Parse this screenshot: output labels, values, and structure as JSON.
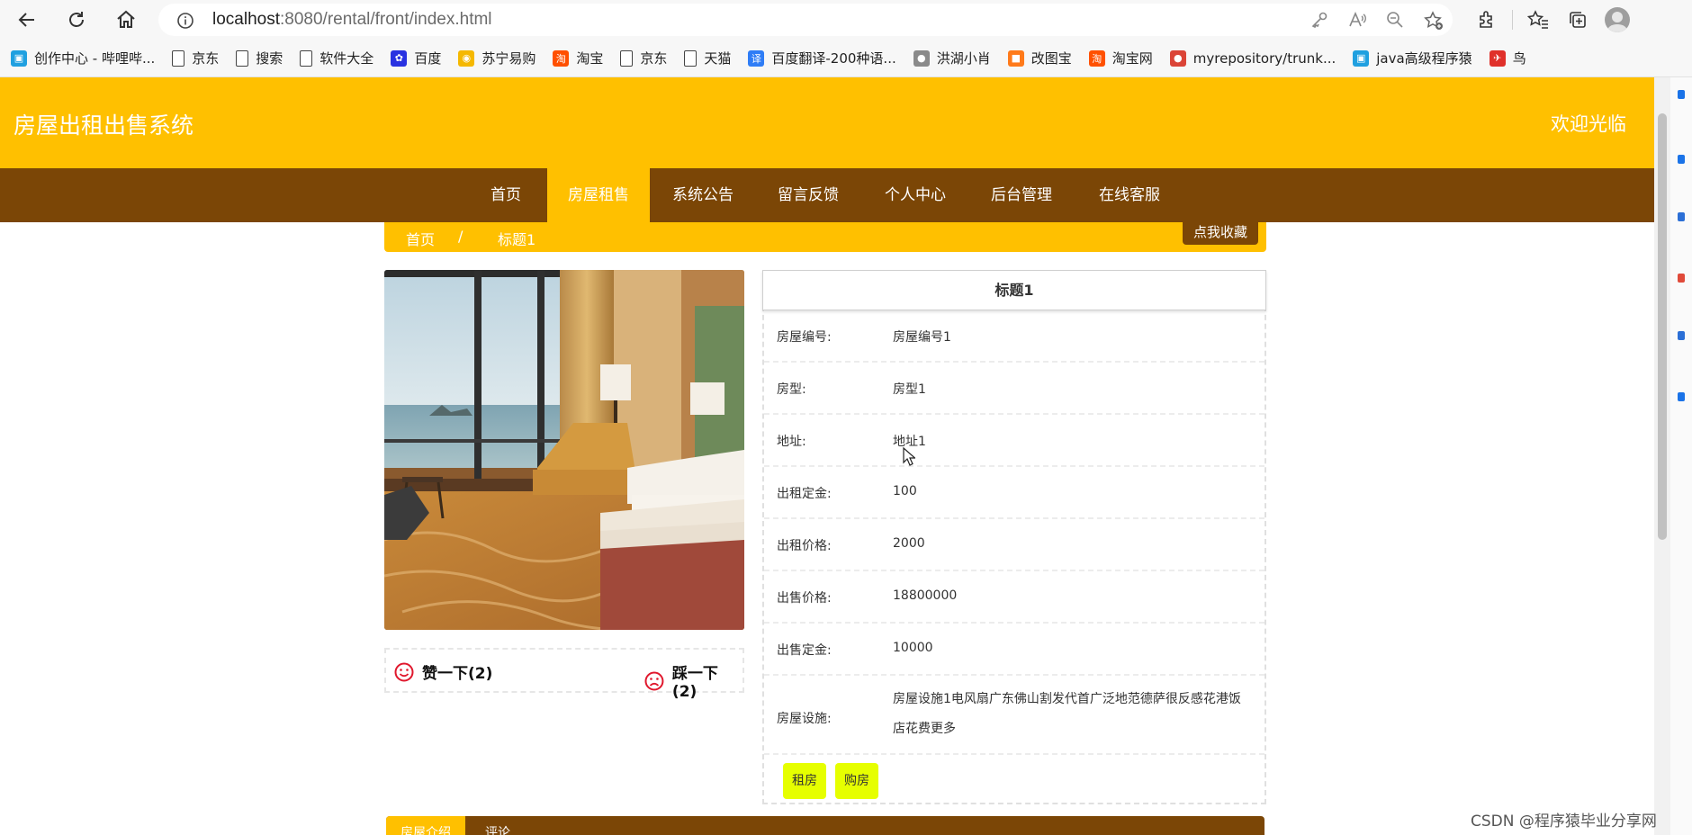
{
  "browser": {
    "url_host": "localhost",
    "url_rest": ":8080/rental/front/index.html",
    "bookmarks": [
      {
        "label": "创作中心 - 哔哩哔...",
        "icon": "bilibili-icon",
        "color": "#20a0e0"
      },
      {
        "label": "京东",
        "icon": "page-icon",
        "color": ""
      },
      {
        "label": "搜索",
        "icon": "page-icon",
        "color": ""
      },
      {
        "label": "软件大全",
        "icon": "page-icon",
        "color": ""
      },
      {
        "label": "百度",
        "icon": "baidu-paw-icon",
        "color": "#2932e1"
      },
      {
        "label": "苏宁易购",
        "icon": "suning-lion-icon",
        "color": "#f5b800"
      },
      {
        "label": "淘宝",
        "icon": "taobao-icon",
        "color": "#ff5000"
      },
      {
        "label": "京东",
        "icon": "page-icon",
        "color": ""
      },
      {
        "label": "天猫",
        "icon": "page-icon",
        "color": ""
      },
      {
        "label": "百度翻译-200种语...",
        "icon": "baidu-translate-icon",
        "color": "#2f7df6"
      },
      {
        "label": "洪湖小肖",
        "icon": "avatar-small-icon",
        "color": "#8a8a8a"
      },
      {
        "label": "改图宝",
        "icon": "gaitubao-icon",
        "color": "#ff7a1a"
      },
      {
        "label": "淘宝网",
        "icon": "taobao-net-icon",
        "color": "#ff5000"
      },
      {
        "label": "myrepository/trunk...",
        "icon": "chrome-ball-icon",
        "color": "#db4437"
      },
      {
        "label": "java高级程序猿",
        "icon": "bilibili-icon",
        "color": "#20a0e0"
      },
      {
        "label": "鸟",
        "icon": "bird-icon",
        "color": "#e0302a"
      }
    ]
  },
  "site": {
    "title": "房屋出租出售系统",
    "welcome": "欢迎光临",
    "nav": [
      {
        "label": "首页",
        "active": false
      },
      {
        "label": "房屋租售",
        "active": true
      },
      {
        "label": "系统公告",
        "active": false
      },
      {
        "label": "留言反馈",
        "active": false
      },
      {
        "label": "个人中心",
        "active": false
      },
      {
        "label": "后台管理",
        "active": false
      },
      {
        "label": "在线客服",
        "active": false
      }
    ],
    "colors": {
      "header": "#ffc000",
      "nav": "#7b4606",
      "button": "#e6ff00"
    }
  },
  "breadcrumb": {
    "home": "首页",
    "separator": "/",
    "current": "标题1",
    "favorite_button": "点我收藏"
  },
  "votes": {
    "like_label": "赞一下(2)",
    "dislike_label": "踩一下(2)"
  },
  "detail": {
    "title": "标题1",
    "rows": [
      {
        "label": "房屋编号:",
        "value": "房屋编号1"
      },
      {
        "label": "房型:",
        "value": "房型1"
      },
      {
        "label": "地址:",
        "value": "地址1"
      },
      {
        "label": "出租定金:",
        "value": "100"
      },
      {
        "label": "出租价格:",
        "value": "2000"
      },
      {
        "label": "出售价格:",
        "value": "18800000"
      },
      {
        "label": "出售定金:",
        "value": "10000"
      },
      {
        "label": "房屋设施:",
        "value": "房屋设施1电风扇广东佛山割发代首广泛地范德萨很反感花港饭店花费更多"
      }
    ],
    "rent_button": "租房",
    "buy_button": "购房"
  },
  "tabs": [
    {
      "label": "房屋介绍",
      "active": true
    },
    {
      "label": "评论",
      "active": false
    }
  ],
  "watermark": "CSDN @程序猿毕业分享网"
}
